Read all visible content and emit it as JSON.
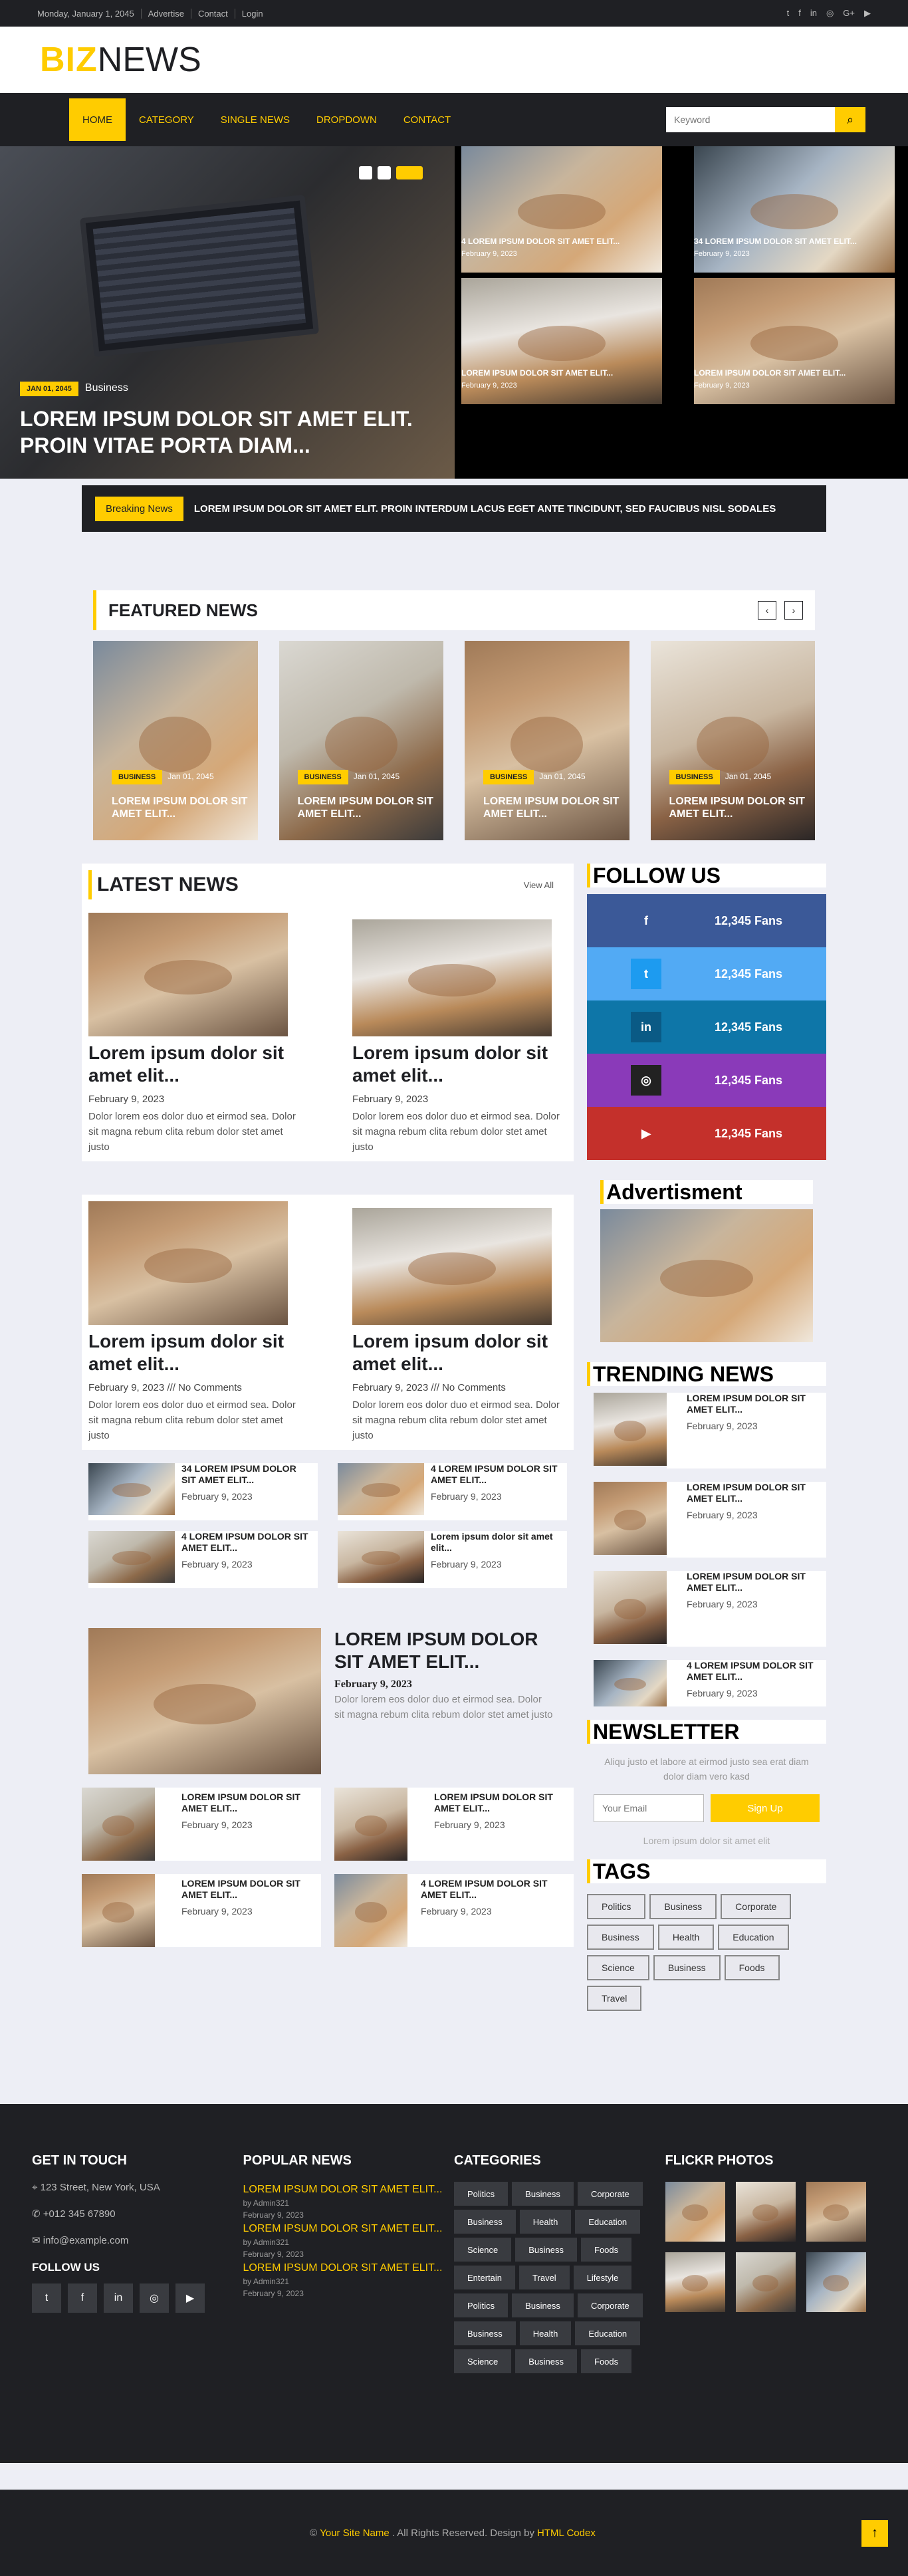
{
  "topbar": {
    "links": [
      "Monday, January 1, 2045",
      "Advertise",
      "Contact",
      "Login"
    ],
    "social_icons": [
      "twitter-icon",
      "facebook-icon",
      "linkedin-icon",
      "instagram-icon",
      "google-plus-icon",
      "youtube-icon"
    ]
  },
  "brand": {
    "part1": "BIZ",
    "part2": "NEWS"
  },
  "nav": {
    "items": [
      "HOME",
      "CATEGORY",
      "SINGLE NEWS",
      "DROPDOWN",
      "CONTACT"
    ],
    "search_placeholder": "Keyword"
  },
  "hero": {
    "badge": "JAN 01, 2045",
    "category": "Business",
    "title": "LOREM IPSUM DOLOR SIT AMET ELIT. PROIN VITAE PORTA DIAM...",
    "tiles": [
      {
        "title": "4 LOREM IPSUM DOLOR SIT AMET ELIT...",
        "date": "February 9, 2023"
      },
      {
        "title": "34 LOREM IPSUM DOLOR SIT AMET ELIT...",
        "date": "February 9, 2023"
      },
      {
        "title": "Lorem ipsum dolor sit amet elit...",
        "date": "February 9, 2023"
      },
      {
        "title": "Lorem ipsum dolor sit amet elit...",
        "date": "February 9, 2023"
      }
    ]
  },
  "breaking": {
    "label": "Breaking News",
    "text": "LOREM IPSUM DOLOR SIT AMET ELIT. PROIN INTERDUM LACUS EGET ANTE TINCIDUNT, SED FAUCIBUS NISL SODALES"
  },
  "featured": {
    "title": "FEATURED NEWS",
    "cards": [
      {
        "badge": "BUSINESS",
        "date": "Jan 01, 2045",
        "title": "LOREM IPSUM DOLOR SIT AMET ELIT..."
      },
      {
        "badge": "BUSINESS",
        "date": "Jan 01, 2045",
        "title": "LOREM IPSUM DOLOR SIT AMET ELIT..."
      },
      {
        "badge": "BUSINESS",
        "date": "Jan 01, 2045",
        "title": "LOREM IPSUM DOLOR SIT AMET ELIT..."
      },
      {
        "badge": "BUSINESS",
        "date": "Jan 01, 2045",
        "title": "LOREM IPSUM DOLOR SIT AMET ELIT..."
      }
    ]
  },
  "latest": {
    "title": "LATEST NEWS",
    "view_all": "View All",
    "row1": [
      {
        "title": "Lorem ipsum dolor sit amet elit...",
        "date": "February 9, 2023",
        "excerpt": "Dolor lorem eos dolor duo et eirmod sea. Dolor sit magna rebum clita rebum dolor stet amet justo"
      },
      {
        "title": "Lorem ipsum dolor sit amet elit...",
        "date": "February 9, 2023",
        "excerpt": "Dolor lorem eos dolor duo et eirmod sea. Dolor sit magna rebum clita rebum dolor stet amet justo"
      }
    ],
    "row2": [
      {
        "title": "Lorem ipsum dolor sit amet elit...",
        "date": "February 9, 2023 /// No Comments",
        "excerpt": "Dolor lorem eos dolor duo et eirmod sea. Dolor sit magna rebum clita rebum dolor stet amet justo"
      },
      {
        "title": "Lorem ipsum dolor sit amet elit...",
        "date": "February 9, 2023 /// No Comments",
        "excerpt": "Dolor lorem eos dolor duo et eirmod sea. Dolor sit magna rebum clita rebum dolor stet amet justo"
      }
    ],
    "small": [
      {
        "title": "34 LOREM IPSUM DOLOR SIT AMET ELIT...",
        "date": "February 9, 2023"
      },
      {
        "title": "4 LOREM IPSUM DOLOR SIT AMET ELIT...",
        "date": "February 9, 2023"
      },
      {
        "title": "4 LOREM IPSUM DOLOR SIT AMET ELIT...",
        "date": "February 9, 2023"
      },
      {
        "title": "Lorem ipsum dolor sit amet elit...",
        "date": "February 9, 2023"
      }
    ],
    "big": {
      "title": "LOREM IPSUM DOLOR SIT AMET ELIT...",
      "date": "February 9, 2023",
      "excerpt": "Dolor lorem eos dolor duo et eirmod sea. Dolor sit magna rebum clita rebum dolor stet amet justo"
    },
    "bottom": [
      {
        "title": "LOREM IPSUM DOLOR SIT AMET ELIT...",
        "date": "February 9, 2023"
      },
      {
        "title": "LOREM IPSUM DOLOR SIT AMET ELIT...",
        "date": "February 9, 2023"
      },
      {
        "title": "LOREM IPSUM DOLOR SIT AMET ELIT...",
        "date": "February 9, 2023"
      },
      {
        "title": "4 LOREM IPSUM DOLOR SIT AMET ELIT...",
        "date": "February 9, 2023"
      }
    ]
  },
  "follow": {
    "title": "FOLLOW US",
    "items": [
      {
        "icon": "facebook-icon",
        "glyph": "f",
        "value": "12,345 Fans",
        "color": "#3b5998",
        "icon_bg": "#3b5998"
      },
      {
        "icon": "twitter-icon",
        "glyph": "t",
        "value": "12,345 Fans",
        "color": "#52aaf4",
        "icon_bg": "#1d9bf0"
      },
      {
        "icon": "linkedin-icon",
        "glyph": "in",
        "value": "12,345 Fans",
        "color": "#0e76a8",
        "icon_bg": "#0a5a85"
      },
      {
        "icon": "instagram-icon",
        "glyph": "◎",
        "value": "12,345 Fans",
        "color": "#8a3ab9",
        "icon_bg": "#222"
      },
      {
        "icon": "youtube-icon",
        "glyph": "▶",
        "value": "12,345 Fans",
        "color": "#c4302b",
        "icon_bg": "#c4302b"
      }
    ]
  },
  "advert": {
    "title": "Advertisment"
  },
  "trending": {
    "title": "TRENDING NEWS",
    "items": [
      {
        "title": "LOREM IPSUM DOLOR SIT AMET ELIT...",
        "date": "February 9, 2023"
      },
      {
        "title": "LOREM IPSUM DOLOR SIT AMET ELIT...",
        "date": "February 9, 2023"
      },
      {
        "title": "LOREM IPSUM DOLOR SIT AMET ELIT...",
        "date": "February 9, 2023"
      },
      {
        "title": "4 LOREM IPSUM DOLOR SIT AMET ELIT...",
        "date": "February 9, 2023"
      }
    ]
  },
  "newsletter": {
    "title": "NEWSLETTER",
    "text": "Aliqu justo et labore at eirmod justo sea erat diam dolor diam vero kasd",
    "placeholder": "Your Email",
    "button": "Sign Up",
    "fine": "Lorem ipsum dolor sit amet elit"
  },
  "tags": {
    "title": "TAGS",
    "items": [
      "Politics",
      "Business",
      "Corporate",
      "Business",
      "Health",
      "Education",
      "Science",
      "Business",
      "Foods",
      "Travel"
    ]
  },
  "footer": {
    "touch": {
      "title": "GET IN TOUCH",
      "address": "123 Street, New York, USA",
      "phone": "+012 345 67890",
      "email": "info@example.com",
      "follow": "FOLLOW US"
    },
    "popular": {
      "title": "POPULAR NEWS",
      "items": [
        {
          "title": "LOREM IPSUM DOLOR SIT AMET ELIT...",
          "by": "by Admin321",
          "date": "February 9, 2023"
        },
        {
          "title": "LOREM IPSUM DOLOR SIT AMET ELIT...",
          "by": "by Admin321",
          "date": "February 9, 2023"
        },
        {
          "title": "LOREM IPSUM DOLOR SIT AMET ELIT...",
          "by": "by Admin321",
          "date": "February 9, 2023"
        }
      ]
    },
    "categories": {
      "title": "CATEGORIES",
      "items": [
        "Politics",
        "Business",
        "Corporate",
        "Business",
        "Health",
        "Education",
        "Science",
        "Business",
        "Foods",
        "Entertain",
        "Travel",
        "Lifestyle",
        "Politics",
        "Business",
        "Corporate",
        "Business",
        "Health",
        "Education",
        "Science",
        "Business",
        "Foods"
      ]
    },
    "flickr": {
      "title": "FLICKR PHOTOS"
    },
    "copyright": {
      "pre": "©",
      "site": "Your Site Name",
      "mid": ". All Rights Reserved. Design by",
      "by": "HTML Codex"
    }
  }
}
